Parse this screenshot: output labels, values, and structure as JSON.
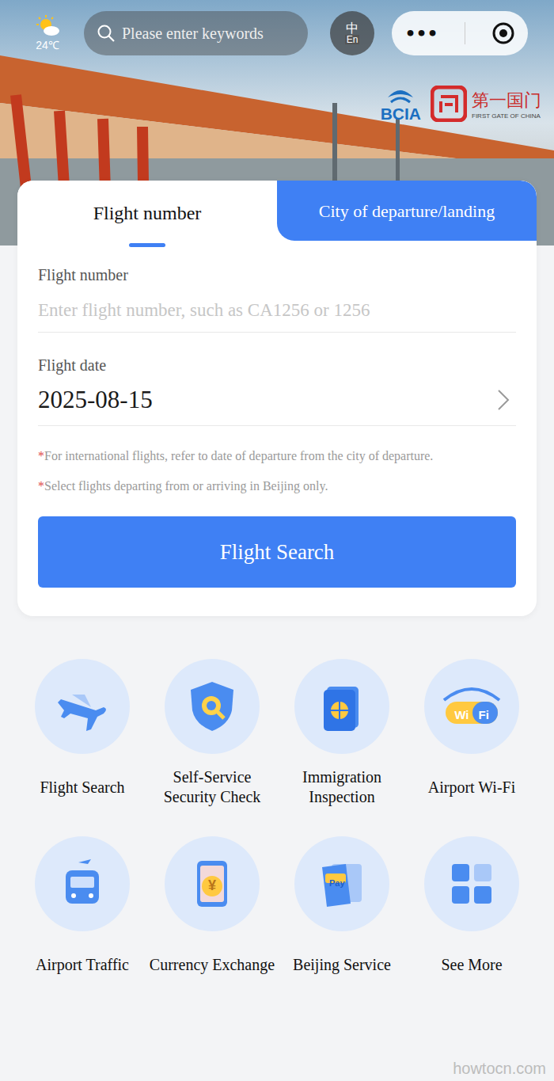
{
  "status": {
    "weather": "24℃"
  },
  "search": {
    "placeholder": "Please enter keywords"
  },
  "translate": {
    "from": "中",
    "to": "En"
  },
  "capsule": {
    "more": "•••"
  },
  "logos": [
    {
      "text": "BCIA",
      "subtitle": ""
    },
    {
      "text": "第一国门",
      "subtitle": "FIRST GATE OF CHINA"
    }
  ],
  "tabs": [
    {
      "label": "Flight number",
      "selected": true
    },
    {
      "label": "City of departure/landing",
      "selected": false
    }
  ],
  "form": {
    "number_label": "Flight number",
    "number_placeholder": "Enter flight number, such as CA1256 or 1256",
    "date_label": "Flight date",
    "date_value": "2025-08-15"
  },
  "notes": [
    {
      "mark": "*",
      "text": "For international flights, refer to date of departure from the city of departure."
    },
    {
      "mark": "*",
      "text": "Select flights departing from or arriving in Beijing only."
    }
  ],
  "search_button": "Flight Search",
  "services": [
    {
      "label": "Flight Search",
      "kind": "plane",
      "icon_text": ""
    },
    {
      "label": "Self-Service Security Check",
      "kind": "shield",
      "icon_text": ""
    },
    {
      "label": "Immigration Inspection",
      "kind": "passport",
      "icon_text": ""
    },
    {
      "label": "Airport Wi-Fi",
      "kind": "wifi",
      "icon_text": "Wi Fi"
    },
    {
      "label": "Airport Traffic",
      "kind": "bus",
      "icon_text": ""
    },
    {
      "label": "Currency Exchange",
      "kind": "exchange",
      "icon_text": "¥"
    },
    {
      "label": "Beijing Service",
      "kind": "pay",
      "icon_text": "Pay"
    },
    {
      "label": "See More",
      "kind": "more",
      "icon_text": ""
    }
  ],
  "watermark": "howtocn.com"
}
